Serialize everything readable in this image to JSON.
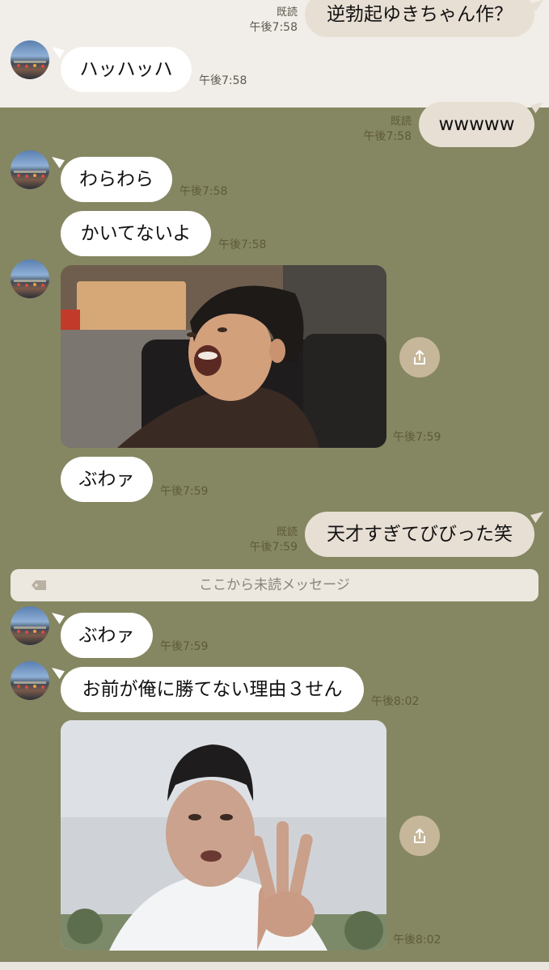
{
  "messages": [
    {
      "id": "m1",
      "side": "out",
      "text": "逆勃起ゆきちゃん作？",
      "read": "既読",
      "time": "午後7:58"
    },
    {
      "id": "m2",
      "side": "in",
      "text": "ハッハッハ",
      "time": "午後7:58"
    },
    {
      "id": "m3",
      "side": "out",
      "text": "wwwww",
      "read": "既読",
      "time": "午後7:58"
    },
    {
      "id": "m4",
      "side": "in",
      "text": "わらわら",
      "time": "午後7:58"
    },
    {
      "id": "m5",
      "side": "in",
      "text": "かいてないよ",
      "time": "午後7:58"
    },
    {
      "id": "m6",
      "side": "in",
      "type": "image",
      "description": "man-laughing-photo",
      "time": "午後7:59"
    },
    {
      "id": "m7",
      "side": "in",
      "text": "ぶわァ",
      "time": "午後7:59"
    },
    {
      "id": "m8",
      "side": "out",
      "text": "天才すぎてびびった笑",
      "read": "既読",
      "time": "午後7:59"
    },
    {
      "id": "m9",
      "side": "in",
      "text": "ぶわァ",
      "time": "午後7:59"
    },
    {
      "id": "m10",
      "side": "in",
      "text": "お前が俺に勝てない理由３せん",
      "time": "午後8:02"
    },
    {
      "id": "m11",
      "side": "in",
      "type": "image",
      "description": "man-three-fingers-photo",
      "time": "午後8:02"
    }
  ],
  "unread_divider": {
    "label": "ここから未読メッセージ"
  },
  "icons": {
    "share": "share-icon",
    "unread_tag": "tag-icon"
  },
  "colors": {
    "chat_bg": "#858762",
    "incoming_bubble": "#ffffff",
    "outgoing_bubble": "#e8dfd4",
    "share_button": "#c6b79a",
    "top_band": "#f1ede8"
  }
}
